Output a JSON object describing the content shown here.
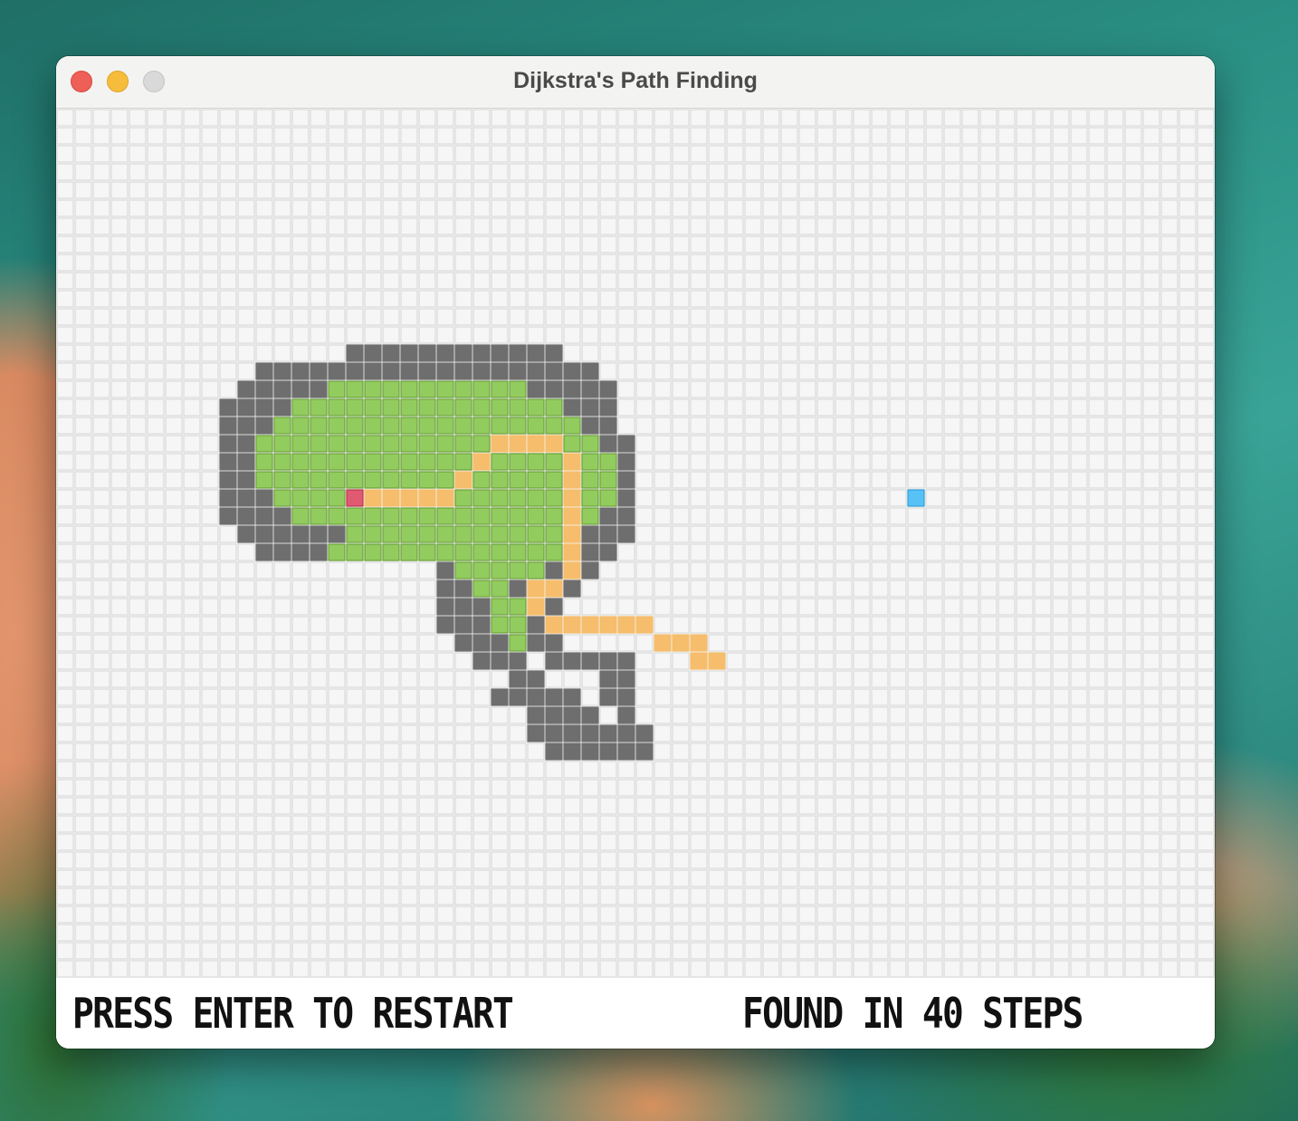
{
  "window": {
    "title": "Dijkstra's Path Finding",
    "controls": [
      "close",
      "minimize",
      "zoom"
    ]
  },
  "status": {
    "left": "PRESS ENTER TO RESTART",
    "right": "FOUND IN 40 STEPS"
  },
  "grid": {
    "cols": 64,
    "rows": 48,
    "cell_colors": {
      "empty": "#f6f6f6",
      "grid_line": "#e1e1e1",
      "wall": "#6e6e6e",
      "visited": "#92cc5e",
      "visited_line": "#6aa03a",
      "path": "#f5bd6c",
      "start": "#e05a72",
      "goal": "#58c2f6"
    },
    "walls": [
      [
        13,
        16,
        27
      ],
      [
        14,
        11,
        29
      ],
      [
        15,
        10,
        14
      ],
      [
        15,
        26,
        30
      ],
      [
        16,
        9,
        12
      ],
      [
        16,
        28,
        30
      ],
      [
        17,
        9,
        11
      ],
      [
        17,
        29,
        30
      ],
      [
        18,
        9,
        10
      ],
      [
        18,
        30,
        31
      ],
      [
        19,
        9,
        10
      ],
      [
        19,
        31,
        31
      ],
      [
        20,
        9,
        10
      ],
      [
        20,
        31,
        31
      ],
      [
        21,
        9,
        11
      ],
      [
        21,
        31,
        31
      ],
      [
        22,
        9,
        12
      ],
      [
        22,
        30,
        31
      ],
      [
        23,
        10,
        15
      ],
      [
        23,
        29,
        31
      ],
      [
        24,
        11,
        14
      ],
      [
        24,
        28,
        30
      ],
      [
        25,
        21,
        21
      ],
      [
        25,
        27,
        29
      ],
      [
        26,
        21,
        22
      ],
      [
        26,
        25,
        28
      ],
      [
        27,
        21,
        23
      ],
      [
        27,
        26,
        27
      ],
      [
        28,
        21,
        23
      ],
      [
        28,
        26,
        27
      ],
      [
        29,
        22,
        24
      ],
      [
        29,
        26,
        27
      ],
      [
        30,
        23,
        25
      ],
      [
        30,
        27,
        31
      ],
      [
        31,
        25,
        26
      ],
      [
        31,
        30,
        31
      ],
      [
        32,
        24,
        28
      ],
      [
        32,
        30,
        31
      ],
      [
        33,
        26,
        29
      ],
      [
        33,
        31,
        31
      ],
      [
        34,
        26,
        32
      ],
      [
        35,
        27,
        32
      ]
    ],
    "visited": [
      [
        15,
        15,
        25
      ],
      [
        16,
        13,
        27
      ],
      [
        17,
        12,
        28
      ],
      [
        18,
        11,
        29
      ],
      [
        19,
        11,
        30
      ],
      [
        20,
        11,
        30
      ],
      [
        21,
        12,
        30
      ],
      [
        22,
        13,
        29
      ],
      [
        23,
        16,
        28
      ],
      [
        24,
        15,
        27
      ],
      [
        25,
        22,
        26
      ],
      [
        26,
        23,
        24
      ],
      [
        27,
        24,
        25
      ],
      [
        28,
        24,
        25
      ],
      [
        29,
        25,
        25
      ]
    ],
    "path": [
      [
        18,
        24,
        27
      ],
      [
        19,
        23,
        23
      ],
      [
        19,
        28,
        28
      ],
      [
        20,
        22,
        22
      ],
      [
        20,
        28,
        28
      ],
      [
        21,
        16,
        21
      ],
      [
        21,
        28,
        28
      ],
      [
        22,
        28,
        28
      ],
      [
        23,
        28,
        28
      ],
      [
        24,
        28,
        28
      ],
      [
        25,
        28,
        28
      ],
      [
        26,
        26,
        27
      ],
      [
        27,
        26,
        26
      ],
      [
        28,
        27,
        32
      ],
      [
        29,
        33,
        35
      ],
      [
        30,
        35,
        36
      ]
    ],
    "start": [
      21,
      16
    ],
    "goal": [
      21,
      47
    ]
  }
}
